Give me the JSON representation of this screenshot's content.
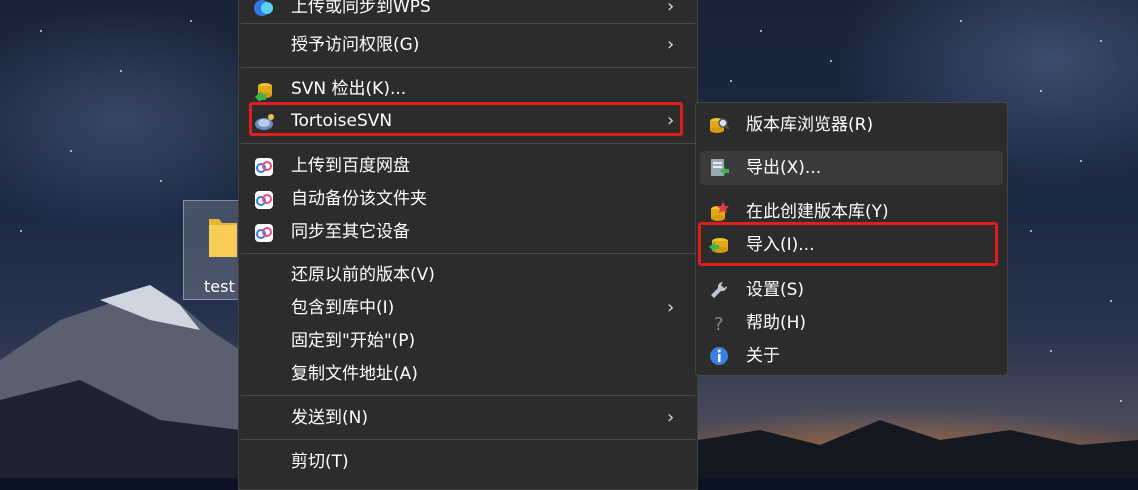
{
  "desktop": {
    "file_label": "test"
  },
  "context_menu": {
    "items": [
      {
        "label": "上传或同步到WPS",
        "icon": "wps-cloud-icon",
        "submenu": true
      },
      {
        "label": "授予访问权限(G)",
        "icon": "",
        "submenu": true
      },
      {
        "label": "SVN 检出(K)...",
        "icon": "svn-checkout-icon",
        "submenu": false
      },
      {
        "label": "TortoiseSVN",
        "icon": "tortoisesvn-icon",
        "submenu": true
      },
      {
        "label": "上传到百度网盘",
        "icon": "baidu-netdisk-icon",
        "submenu": false
      },
      {
        "label": "自动备份该文件夹",
        "icon": "baidu-netdisk-icon",
        "submenu": false
      },
      {
        "label": "同步至其它设备",
        "icon": "baidu-netdisk-icon",
        "submenu": false
      },
      {
        "label": "还原以前的版本(V)",
        "icon": "",
        "submenu": false
      },
      {
        "label": "包含到库中(I)",
        "icon": "",
        "submenu": true
      },
      {
        "label": "固定到\"开始\"(P)",
        "icon": "",
        "submenu": false
      },
      {
        "label": "复制文件地址(A)",
        "icon": "",
        "submenu": false
      },
      {
        "label": "发送到(N)",
        "icon": "",
        "submenu": true
      },
      {
        "label": "剪切(T)",
        "icon": "",
        "submenu": false
      }
    ],
    "arrow_glyph": "›"
  },
  "submenu": {
    "items": [
      {
        "label": "版本库浏览器(R)",
        "icon": "repo-browser-icon"
      },
      {
        "label": "导出(X)...",
        "icon": "export-icon"
      },
      {
        "label": "在此创建版本库(Y)",
        "icon": "create-repo-icon"
      },
      {
        "label": "导入(I)...",
        "icon": "import-icon"
      },
      {
        "label": "设置(S)",
        "icon": "wrench-icon"
      },
      {
        "label": "帮助(H)",
        "icon": "help-icon"
      },
      {
        "label": "关于",
        "icon": "info-icon"
      }
    ]
  },
  "colors": {
    "menu_bg": "#2c2c2c",
    "highlight_border": "#e01e1e",
    "hover_bg": "#3b3b3b"
  }
}
